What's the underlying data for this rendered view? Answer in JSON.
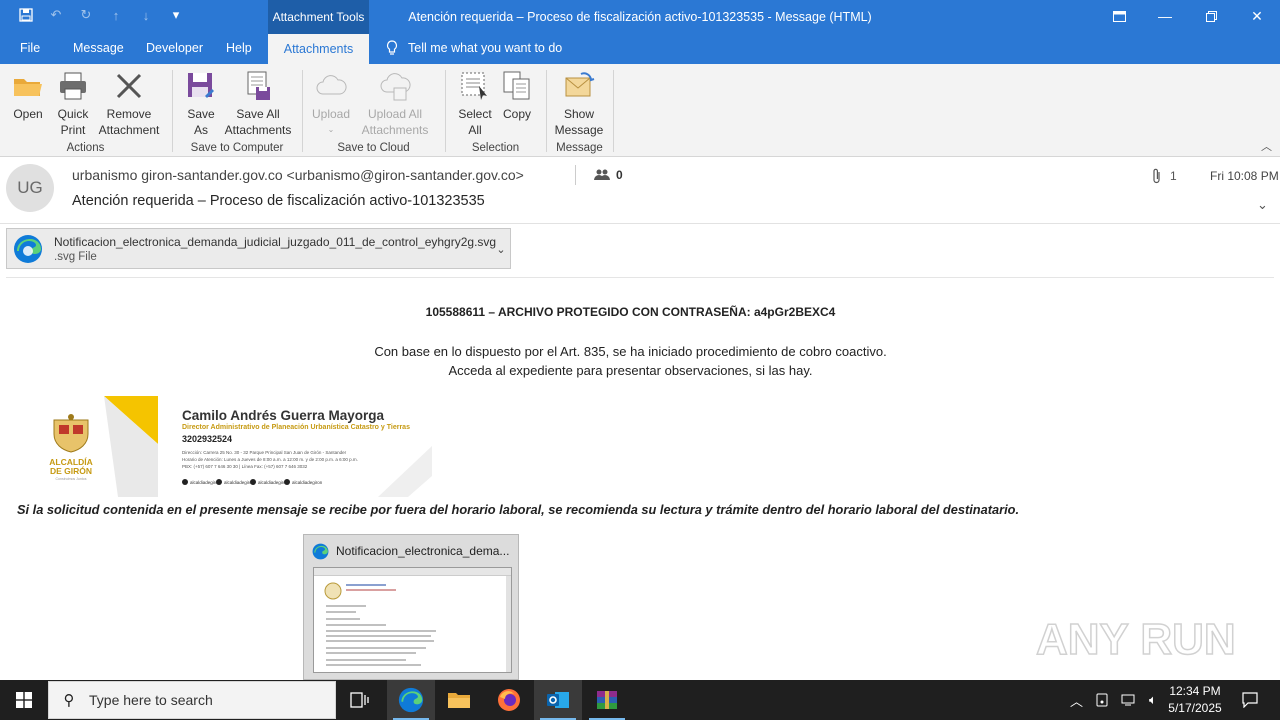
{
  "window": {
    "context_tab": "Attachment Tools",
    "title": "Atención requerida – Proceso de fiscalización activo-101323535  -  Message (HTML)"
  },
  "menu": {
    "file": "File",
    "message": "Message",
    "developer": "Developer",
    "help": "Help",
    "attachments": "Attachments",
    "tell_me": "Tell me what you want to do"
  },
  "ribbon": {
    "open": "Open",
    "quick_print": [
      "Quick",
      "Print"
    ],
    "remove_attachment": [
      "Remove",
      "Attachment"
    ],
    "actions_label": "Actions",
    "save_as": [
      "Save",
      "As"
    ],
    "save_all": [
      "Save All",
      "Attachments"
    ],
    "save_computer_label": "Save to Computer",
    "upload": "Upload",
    "upload_all": [
      "Upload All",
      "Attachments"
    ],
    "save_cloud_label": "Save to Cloud",
    "select_all": [
      "Select",
      "All"
    ],
    "copy": "Copy",
    "selection_label": "Selection",
    "show_message": [
      "Show",
      "Message"
    ],
    "message_label": "Message"
  },
  "header": {
    "avatar_initials": "UG",
    "sender": "urbanismo giron-santander.gov.co <urbanismo@giron-santander.gov.co>",
    "people_count": "0",
    "subject": "Atención requerida – Proceso de fiscalización activo-101323535",
    "attachment_count": "1",
    "sent": "Fri 10:08 PM"
  },
  "attachment": {
    "name": "Notificacion_electronica_demanda_judicial_juzgado_011_de_control_eyhgry2g.svg",
    "type": ".svg File"
  },
  "body": {
    "line1": "105588611  – ARCHIVO PROTEGIDO CON CONTRASEÑA:  a4pGr2BEXC4",
    "line2": "Con base en lo dispuesto por el Art. 835, se ha iniciado procedimiento de cobro coactivo.",
    "line3": "Acceda al expediente para presentar observaciones, si las hay.",
    "footer": "Si la solicitud contenida en el presente mensaje se recibe por fuera del horario laboral, se recomienda su lectura y trámite dentro del horario laboral del destinatario."
  },
  "signature": {
    "name": "Camilo Andrés Guerra Mayorga",
    "role": "Director Administrativo de Planeación Urbanística Catastro y Tierras",
    "phone": "3202932524",
    "address": "Dirección: Carrera 25 No. 30 - 32 Parque Principal San Juan de Girón - Santander",
    "hours": "Horario de Atención: Lunes a Jueves de 8:00 a.m. a 12:00 m. y de 2:00 p.m. a 6:00 p.m.",
    "pbx": "PBX: (+57) 607 7 646 30 30 | Línea Fax: (+57) 607 7 646 3032",
    "social": [
      "alcaldiadegiron",
      "alcaldiadegiron",
      "alcaldiadegiron",
      "alcaldiadegiron"
    ],
    "logo_text": [
      "ALCALDÍA",
      "DE GIRÓN"
    ],
    "logo_sub": "Construimos Juntos"
  },
  "thumbnail": {
    "title": "Notificacion_electronica_dema..."
  },
  "watermark": {
    "text": "ANY RUN"
  },
  "taskbar": {
    "search_placeholder": "Type here to search",
    "time": "12:34 PM",
    "date": "5/17/2025"
  },
  "colors": {
    "accent": "#2b78d4",
    "ribbon_bg": "#f3f3f3",
    "taskbar": "#1f1f1f",
    "signature_gold": "#c69a12"
  }
}
